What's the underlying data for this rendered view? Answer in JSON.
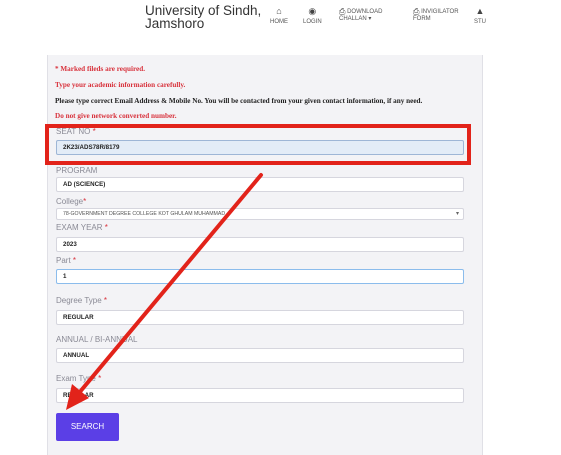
{
  "header": {
    "brand_line1": "University of Sindh,",
    "brand_line2": "Jamshoro",
    "nav": [
      {
        "label": "HOME",
        "icon": "home-icon"
      },
      {
        "label": "LOGIN",
        "icon": "dashboard-icon"
      },
      {
        "label": "DOWNLOAD",
        "label2": "CHALLAN ▾",
        "icon": "print-icon"
      },
      {
        "label": "INVIGILATOR",
        "label2": "FORM",
        "icon": "print-icon"
      },
      {
        "label": "STU",
        "icon": "graduation-cap-icon"
      }
    ]
  },
  "notes": {
    "marked": "* Marked fileds are required.",
    "type_info": "Type your academic information carefully.",
    "email": "Please type correct Email Address & Mobile No. You will be contacted from your given contact information, if any need.",
    "converted": "Do not give network converted number."
  },
  "form": {
    "seat_no": {
      "label": "SEAT NO",
      "value": "2K23/ADS78R/8179"
    },
    "program": {
      "label": "PROGRAM",
      "value": "AD (SCIENCE)"
    },
    "college": {
      "label": "College",
      "value": "78-GOVERNMENT DEGREE COLLEGE KOT GHULAM MUHAMMAD"
    },
    "exam_year": {
      "label": "EXAM YEAR",
      "value": "2023"
    },
    "part": {
      "label": "Part",
      "value": "1"
    },
    "degree_type": {
      "label": "Degree Type",
      "value": "REGULAR"
    },
    "annual": {
      "label": "ANNUAL / BI-ANNUAL",
      "value": "ANNUAL"
    },
    "exam_type": {
      "label": "Exam Type",
      "value": "REGULAR"
    },
    "required_mark": "*",
    "search_label": "SEARCH"
  },
  "colors": {
    "accent": "#5b3fe6",
    "annotation": "#e2231a",
    "required": "#d8323c"
  }
}
